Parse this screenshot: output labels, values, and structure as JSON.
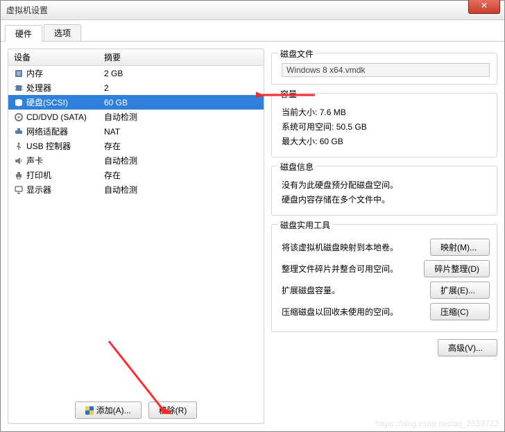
{
  "window": {
    "title": "虚拟机设置"
  },
  "tabs": {
    "hardware": "硬件",
    "options": "选项"
  },
  "devtable": {
    "col_device": "设备",
    "col_summary": "摘要",
    "rows": [
      {
        "name": "内存",
        "summary": "2 GB",
        "icon": "chip"
      },
      {
        "name": "处理器",
        "summary": "2",
        "icon": "cpu"
      },
      {
        "name": "硬盘(SCSI)",
        "summary": "60 GB",
        "icon": "disk",
        "selected": true
      },
      {
        "name": "CD/DVD (SATA)",
        "summary": "自动检测",
        "icon": "cd"
      },
      {
        "name": "网络适配器",
        "summary": "NAT",
        "icon": "net"
      },
      {
        "name": "USB 控制器",
        "summary": "存在",
        "icon": "usb"
      },
      {
        "name": "声卡",
        "summary": "自动检测",
        "icon": "sound"
      },
      {
        "name": "打印机",
        "summary": "存在",
        "icon": "printer"
      },
      {
        "name": "显示器",
        "summary": "自动检测",
        "icon": "display"
      }
    ]
  },
  "buttons": {
    "add": "添加(A)...",
    "remove": "移除(R)"
  },
  "diskfile": {
    "title": "磁盘文件",
    "value": "Windows 8 x64.vmdk"
  },
  "capacity": {
    "title": "容量",
    "current_label": "当前大小:",
    "current_value": "7.6 MB",
    "free_label": "系统可用空间:",
    "free_value": "50.5 GB",
    "max_label": "最大大小:",
    "max_value": "60 GB"
  },
  "diskinfo": {
    "title": "磁盘信息",
    "line1": "没有为此硬盘预分配磁盘空间。",
    "line2": "硬盘内容存储在多个文件中。"
  },
  "tools": {
    "title": "磁盘实用工具",
    "map_label": "将该虚拟机磁盘映射到本地卷。",
    "map_btn": "映射(M)...",
    "defrag_label": "整理文件碎片并整合可用空间。",
    "defrag_btn": "碎片整理(D)",
    "expand_label": "扩展磁盘容量。",
    "expand_btn": "扩展(E)...",
    "compact_label": "压缩磁盘以回收未使用的空间。",
    "compact_btn": "压缩(C)"
  },
  "advanced": {
    "btn": "高级(V)..."
  },
  "watermark": "https://blog.csdn.net/qq_2533722"
}
